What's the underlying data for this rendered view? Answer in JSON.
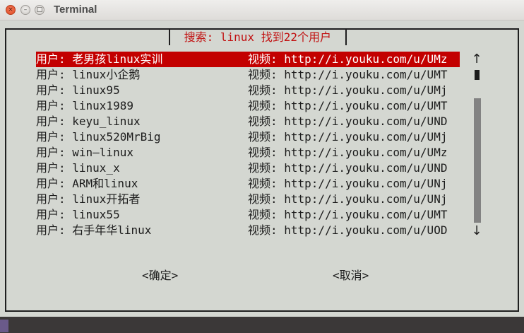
{
  "window": {
    "title": "Terminal",
    "close_glyph": "×",
    "minimize_glyph": "–",
    "maximize_glyph": "□"
  },
  "dialog": {
    "title": " 搜索: linux 找到22个用户 ",
    "rows": [
      {
        "name": "用户: 老男孩linux实训",
        "url": "视频: http://i.youku.com/u/UMz",
        "selected": true
      },
      {
        "name": "用户: linux小企鹅",
        "url": "视频: http://i.youku.com/u/UMT",
        "selected": false
      },
      {
        "name": "用户: linux95",
        "url": "视频: http://i.youku.com/u/UMj",
        "selected": false
      },
      {
        "name": "用户: linux1989",
        "url": "视频: http://i.youku.com/u/UMT",
        "selected": false
      },
      {
        "name": "用户: keyu_linux",
        "url": "视频: http://i.youku.com/u/UND",
        "selected": false
      },
      {
        "name": "用户: linux520MrBig",
        "url": "视频: http://i.youku.com/u/UMj",
        "selected": false
      },
      {
        "name": "用户: win—linux",
        "url": "视频: http://i.youku.com/u/UMz",
        "selected": false
      },
      {
        "name": "用户: linux_x",
        "url": "视频: http://i.youku.com/u/UND",
        "selected": false
      },
      {
        "name": "用户: ARM和linux",
        "url": "视频: http://i.youku.com/u/UNj",
        "selected": false
      },
      {
        "name": "用户: linux开拓者",
        "url": "视频: http://i.youku.com/u/UNj",
        "selected": false
      },
      {
        "name": "用户: linux55",
        "url": "视频: http://i.youku.com/u/UMT",
        "selected": false
      },
      {
        "name": "用户: 右手年华linux",
        "url": "视频: http://i.youku.com/u/UOD",
        "selected": false
      }
    ],
    "scroll_up_glyph": "↑",
    "scroll_down_glyph": "↓",
    "ok_label": "<确定>",
    "cancel_label": "<取消>"
  },
  "colors": {
    "selection_bg": "#c30000",
    "title_text": "#c11010",
    "terminal_bg": "#d4d7d1"
  },
  "icons": [
    "close-icon",
    "minimize-icon",
    "maximize-icon",
    "scroll-up-arrow-icon",
    "scroll-down-arrow-icon"
  ]
}
